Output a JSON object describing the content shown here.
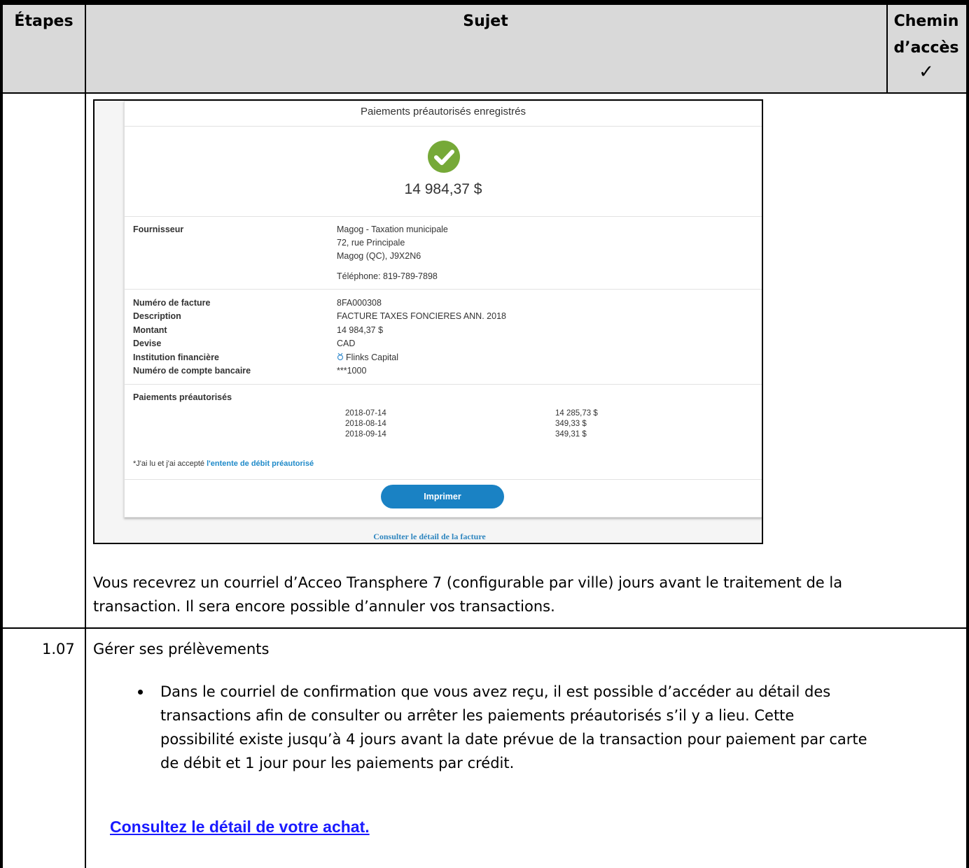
{
  "table": {
    "headers": {
      "etapes": "Étapes",
      "sujet": "Sujet",
      "chemin_line1": "Chemin",
      "chemin_line2": "d’accès",
      "chemin_mark": "✓"
    }
  },
  "screenshot": {
    "title": "Paiements préautorisés enregistrés",
    "amount": "14 984,37 $",
    "fournisseur": {
      "label": "Fournisseur",
      "line1": "Magog - Taxation municipale",
      "line2": "72, rue Principale",
      "line3": "Magog (QC), J9X2N6",
      "phone": "Téléphone: 819-789-7898"
    },
    "details": [
      {
        "label": "Numéro de facture",
        "value": "8FA000308"
      },
      {
        "label": "Description",
        "value": "FACTURE TAXES FONCIERES ANN. 2018"
      },
      {
        "label": "Montant",
        "value": "14 984,37 $"
      },
      {
        "label": "Devise",
        "value": "CAD"
      },
      {
        "label": "Institution financière",
        "value": "Flinks Capital"
      },
      {
        "label": "Numéro de compte bancaire",
        "value": "***1000"
      }
    ],
    "payments": {
      "label": "Paiements préautorisés",
      "rows": [
        {
          "date": "2018-07-14",
          "amount": "14 285,73 $"
        },
        {
          "date": "2018-08-14",
          "amount": "349,33 $"
        },
        {
          "date": "2018-09-14",
          "amount": "349,31 $"
        }
      ]
    },
    "agreement_prefix": "*J'ai lu et j'ai accepté ",
    "agreement_link": "l'entente de débit préautorisé",
    "print_button": "Imprimer",
    "invoice_link": "Consulter le détail de la facture"
  },
  "row1": {
    "paragraph_line1": "Vous recevrez un courriel d’Acceo Transphere 7 (configurable par ville) jours avant le traitement de la",
    "paragraph_line2": "transaction. Il sera encore possible d’annuler vos transactions."
  },
  "row2": {
    "step": "1.07",
    "title": "Gérer ses prélèvements",
    "bullet_lines": [
      "Dans le courriel de confirmation que vous avez reçu, il est possible d’accéder au détail des",
      "transactions afin de consulter ou arrêter les paiements préautorisés s’il y a lieu. Cette",
      "possibilité existe jusqu’à 4 jours avant la date prévue de la transaction pour paiement par carte",
      "de débit et 1 jour pour les paiements par crédit."
    ],
    "consult_link": "Consultez le détail de votre achat."
  }
}
